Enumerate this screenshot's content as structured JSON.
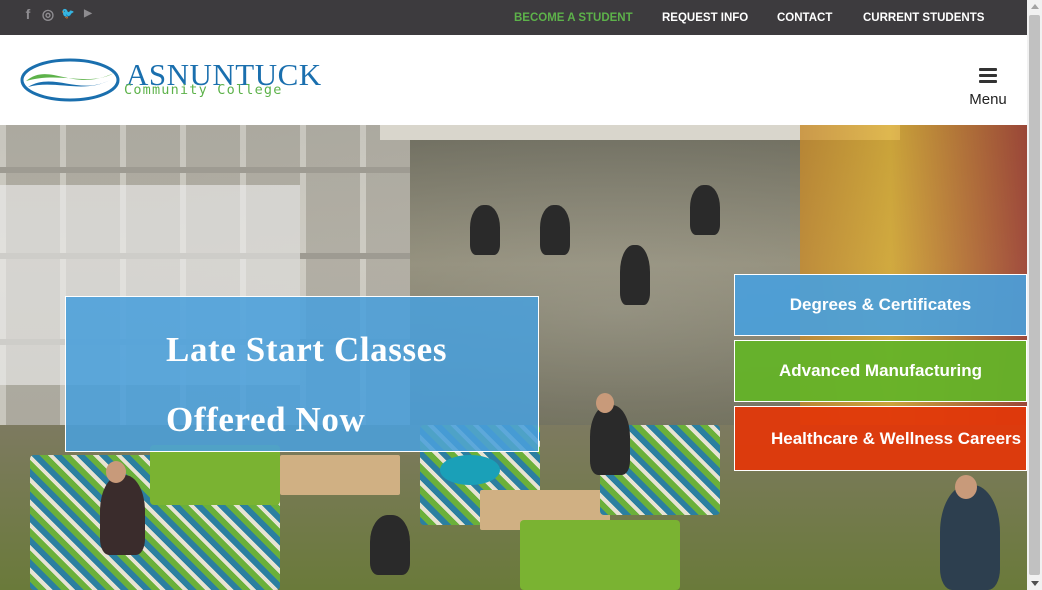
{
  "colors": {
    "topbar": "#3d3b3e",
    "accent_green": "#5db24a",
    "brand_blue": "#1a6fae",
    "promo_blue": "#4a9fdb",
    "btn_green": "#64b328",
    "btn_red": "#e2380a"
  },
  "social": {
    "facebook": "f",
    "instagram": "◎",
    "twitter": "🐦",
    "youtube": "▶"
  },
  "toplinks": {
    "become_student": "BECOME A STUDENT",
    "request_info": "REQUEST INFO",
    "contact": "CONTACT",
    "current_students": "CURRENT STUDENTS"
  },
  "logo": {
    "name": "ASNUNTUCK",
    "sub": "Community College"
  },
  "menu": {
    "label": "Menu"
  },
  "promo": {
    "line1": "Late Start Classes",
    "line2": "Offered Now"
  },
  "buttons": {
    "degrees": "Degrees & Certificates",
    "manufacturing": "Advanced Manufacturing",
    "healthcare": "Healthcare & Wellness Careers"
  }
}
